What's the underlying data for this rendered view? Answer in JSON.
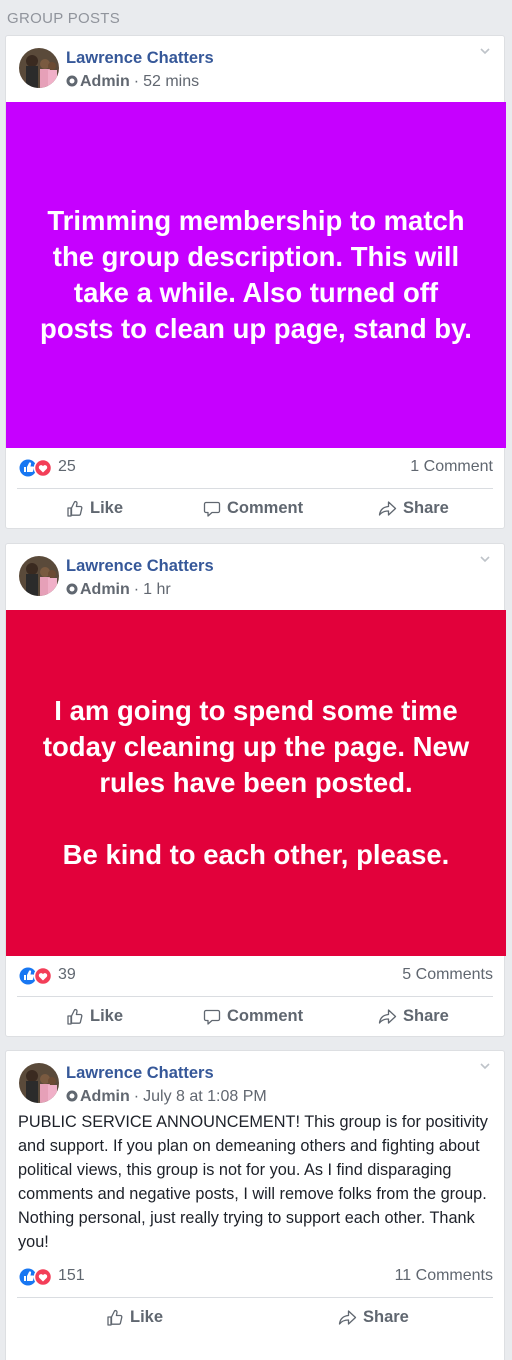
{
  "section": {
    "title": "GROUP POSTS"
  },
  "colors": {
    "post1_banner": "#c600ff",
    "post2_banner": "#e2013b",
    "link": "#365899",
    "like_blue": "#1877f2",
    "love_red": "#f33e58"
  },
  "posts": [
    {
      "author": "Lawrence Chatters",
      "role": "Admin",
      "separator": "·",
      "time": "52 mins",
      "banner_text": "Trimming membership to match the group description. This will take a while. Also turned off posts to clean up page, stand by.",
      "reactions": "25",
      "comments": "1 Comment",
      "actions": {
        "like": "Like",
        "comment": "Comment",
        "share": "Share"
      }
    },
    {
      "author": "Lawrence Chatters",
      "role": "Admin",
      "separator": "·",
      "time": "1 hr",
      "banner_text": "I am going to spend some time today cleaning up the page. New rules have been posted.\n\nBe kind to each other, please.",
      "reactions": "39",
      "comments": "5 Comments",
      "actions": {
        "like": "Like",
        "comment": "Comment",
        "share": "Share"
      }
    },
    {
      "author": "Lawrence Chatters",
      "role": "Admin",
      "separator": "·",
      "time": "July 8 at 1:08 PM",
      "body_text": "PUBLIC SERVICE ANNOUNCEMENT! This group is for positivity and support. If you plan on demeaning others and fighting about political views, this group is not for you. As I find disparaging comments and negative posts, I will remove folks from the group. Nothing personal, just really trying to support each other. Thank you!",
      "reactions": "151",
      "comments": "11 Comments",
      "actions": {
        "like": "Like",
        "share": "Share"
      }
    }
  ]
}
